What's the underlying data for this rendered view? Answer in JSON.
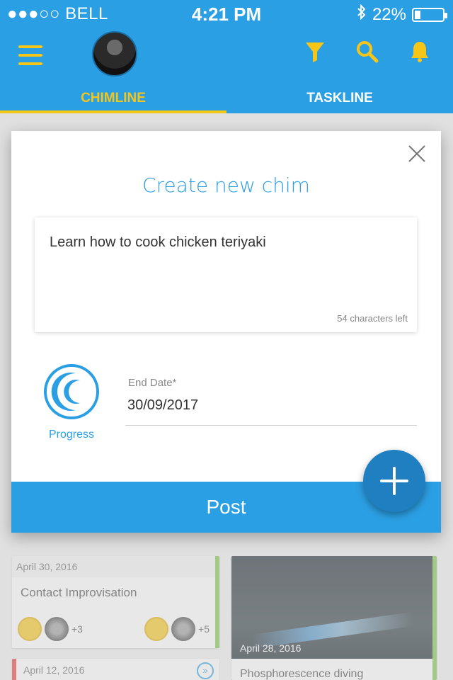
{
  "status_bar": {
    "carrier": "●●●○○ BELL",
    "time": "4:21 PM",
    "battery": "22%",
    "battery_level": 0.22
  },
  "app_bar": {
    "icons": [
      "menu-icon",
      "avatar",
      "filter-icon",
      "search-icon",
      "bell-icon"
    ],
    "accent_color": "#f5c518",
    "primary_color": "#2b9fe3"
  },
  "tabs": [
    {
      "label": "CHIMLINE",
      "active": true
    },
    {
      "label": "TASKLINE",
      "active": false
    }
  ],
  "modal": {
    "title": "Create new chim",
    "text_value": "Learn how to cook chicken teriyaki",
    "chars_left": "54 characters left",
    "progress_label": "Progress",
    "end_date_label": "End Date*",
    "end_date_value": "30/09/2017",
    "post_label": "Post"
  },
  "background_cards": {
    "card1": {
      "date": "April 30, 2016",
      "title": "Contact Improvisation",
      "count_a": "+3",
      "count_b": "+5"
    },
    "card2": {
      "date": "April 28, 2016",
      "caption": "Phosphorescence diving"
    },
    "card3": {
      "date": "April 12, 2016"
    }
  }
}
